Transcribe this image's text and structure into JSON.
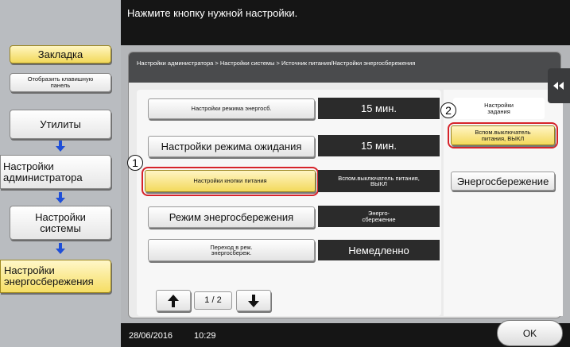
{
  "instruction": "Нажмите кнопку нужной настройки.",
  "sidebar": {
    "bookmark": "Закладка",
    "show_keypad": "Отобразить клавишную панель",
    "items": [
      {
        "label": "Утилиты"
      },
      {
        "label": "Настройки администратора"
      },
      {
        "label": "Настройки системы"
      },
      {
        "label": "Настройки энергосбережения"
      }
    ]
  },
  "breadcrumb": "Настройки администратора > Настройки системы > Источник питания/Настройки энергосбережения",
  "settings": [
    {
      "label": "Настройки режима энергосб.",
      "value": "15 мин."
    },
    {
      "label": "Настройки режима ожидания",
      "value": "15 мин."
    },
    {
      "label": "Настройки кнопки питания",
      "value": "Вспом.выключатель питания, ВЫКЛ"
    },
    {
      "label": "Режим энергосбережения",
      "value": "Энерго-сбережение"
    },
    {
      "label": "Переход в реж. энергосбереж.",
      "value": "Немедленно"
    }
  ],
  "pagination": {
    "page": "1 / 2"
  },
  "right_panel": {
    "title": "Настройки задания",
    "options": [
      {
        "label": "Вспом.выключатель питания, ВЫКЛ"
      },
      {
        "label": "Энергосбережение"
      }
    ]
  },
  "callouts": [
    "1",
    "2"
  ],
  "status": {
    "date": "28/06/2016",
    "time": "10:29"
  },
  "ok_label": "OK",
  "colors": {
    "highlight": "#f3d95c",
    "callout_ring": "#d6232a",
    "dark_bar": "#151515"
  }
}
